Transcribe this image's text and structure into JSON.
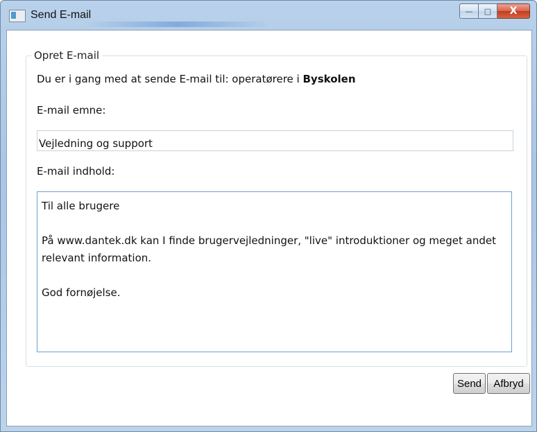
{
  "window": {
    "title": "Send E-mail",
    "controls": {
      "minimize": "—",
      "maximize": "□",
      "close": "X"
    }
  },
  "group": {
    "legend": "Opret E-mail",
    "info_prefix": "Du er i gang med at sende E-mail til: operatørere i ",
    "info_target": "Byskolen",
    "subject_label": "E-mail emne:",
    "subject_value": "Vejledning og support",
    "body_label": "E-mail indhold:",
    "body_lines": {
      "l1": "Til alle brugere",
      "l2": "På www.dantek.dk kan I finde brugervejledninger, \"live\" introduktioner og meget andet relevant information.",
      "l3": "God fornøjelse."
    }
  },
  "buttons": {
    "send": "Send",
    "cancel": "Afbryd"
  },
  "colors": {
    "titlebar": "#b9d1ea",
    "close": "#c23b20",
    "focus_border": "#6e9fcf"
  },
  "icons": {
    "app": "window-app-icon",
    "minimize": "minimize-icon",
    "maximize": "maximize-icon",
    "close": "close-icon"
  }
}
